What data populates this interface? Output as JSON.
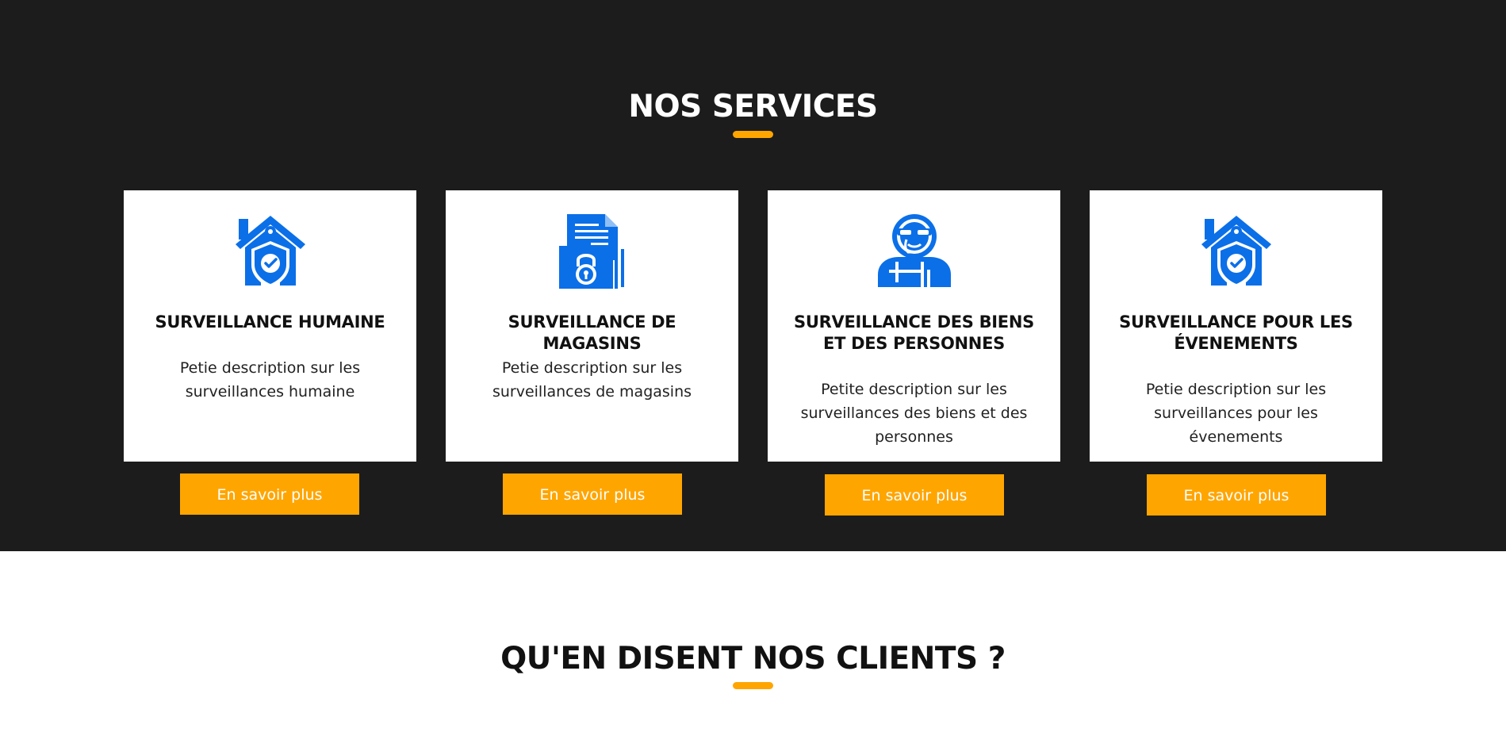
{
  "services": {
    "title": "NOS SERVICES",
    "accent_color": "#ffa500",
    "icon_color": "#0b6fe8",
    "cards": [
      {
        "icon": "house-shield-icon",
        "title": "SURVEILLANCE HUMAINE",
        "description": "Petie description sur les surveillances humaine",
        "button": "En savoir plus"
      },
      {
        "icon": "locked-folder-icon",
        "title": "SURVEILLANCE DE MAGASINS",
        "description": "Petie description sur les surveillances de magasins",
        "button": "En savoir plus"
      },
      {
        "icon": "security-guard-icon",
        "title": "SURVEILLANCE DES BIENS ET DES PERSONNES",
        "description": "Petite description sur les surveillances des biens et des personnes",
        "button": "En savoir plus"
      },
      {
        "icon": "house-shield-icon",
        "title": "SURVEILLANCE POUR LES ÉVENEMENTS",
        "description": "Petie description sur les surveillances pour les évenements",
        "button": "En savoir plus"
      }
    ]
  },
  "clients": {
    "title": "QU'EN DISENT NOS CLIENTS ?"
  }
}
